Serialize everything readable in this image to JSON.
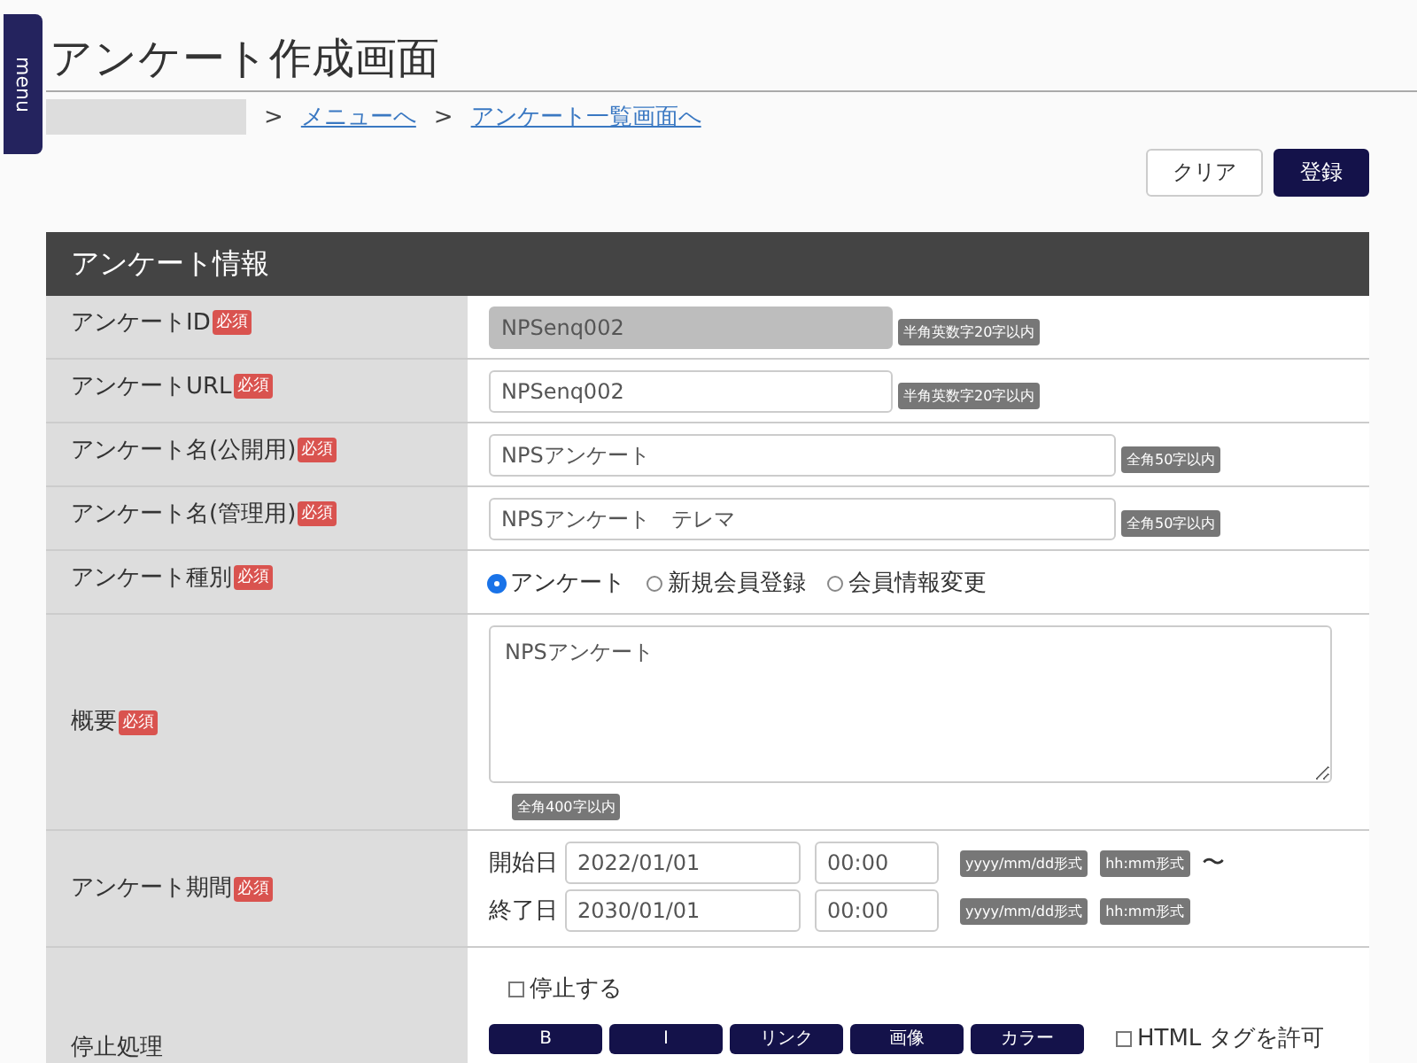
{
  "menu_tab": {
    "label": "menu"
  },
  "page": {
    "title": "アンケート作成画面"
  },
  "breadcrumb": {
    "items": [
      {
        "separator": ">",
        "label": "メニューへ"
      },
      {
        "separator": ">",
        "label": "アンケート一覧画面へ"
      }
    ]
  },
  "actions": [
    {
      "label": "クリア",
      "kind": "secondary"
    },
    {
      "label": "登録",
      "kind": "primary"
    }
  ],
  "panel": {
    "title": "アンケート情報",
    "rows": [
      {
        "label": "アンケートID",
        "badge": "必須",
        "kind": "text",
        "value": "NPSenq002",
        "disabled": true,
        "wide": false,
        "hint": "半角英数字20字以内"
      },
      {
        "label": "アンケートURL",
        "badge": "必須",
        "kind": "text",
        "value": "NPSenq002",
        "disabled": false,
        "wide": false,
        "hint": "半角英数字20字以内"
      },
      {
        "label": "アンケート名(公開用)",
        "badge": "必須",
        "kind": "text",
        "value": "NPSアンケート",
        "disabled": false,
        "wide": true,
        "hint": "全角50字以内"
      },
      {
        "label": "アンケート名(管理用)",
        "badge": "必須",
        "kind": "text",
        "value": "NPSアンケート　テレマ",
        "disabled": false,
        "wide": true,
        "hint": "全角50字以内"
      },
      {
        "label": "アンケート種別",
        "badge": "必須",
        "kind": "radio",
        "options": [
          {
            "label": "アンケート",
            "selected": true
          },
          {
            "label": "新規会員登録",
            "selected": false
          },
          {
            "label": "会員情報変更",
            "selected": false
          }
        ]
      },
      {
        "label": "概要",
        "badge": "必須",
        "kind": "textarea",
        "value": "NPSアンケート",
        "hint": "全角400字以内"
      },
      {
        "label": "アンケート期間",
        "badge": "必須",
        "kind": "period",
        "items": [
          {
            "label": "開始日",
            "date": "2022/01/01",
            "time": "00:00",
            "date_hint": "yyyy/mm/dd形式",
            "time_hint": "hh:mm形式",
            "suffix": "〜"
          },
          {
            "label": "終了日",
            "date": "2030/01/01",
            "time": "00:00",
            "date_hint": "yyyy/mm/dd形式",
            "time_hint": "hh:mm形式"
          }
        ]
      },
      {
        "label": "停止処理",
        "kind": "stop",
        "checkbox": {
          "label": "停止する",
          "checked": false
        },
        "toolbar": [
          "B",
          "I",
          "リンク",
          "画像",
          "カラー"
        ],
        "html_checkbox": {
          "label": "HTML タグを許可",
          "checked": false
        }
      }
    ]
  }
}
